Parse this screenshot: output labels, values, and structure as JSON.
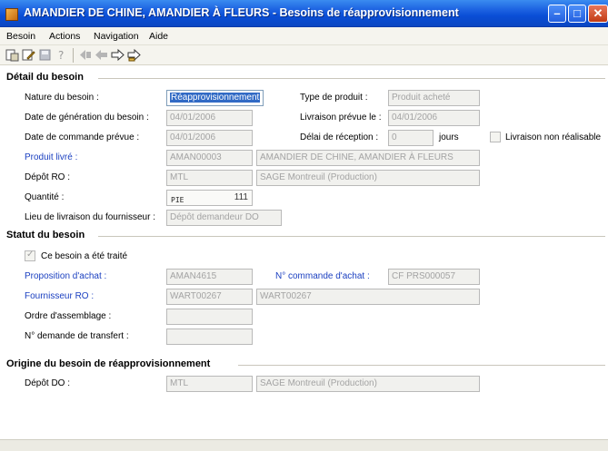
{
  "window": {
    "title": "AMANDIER DE CHINE, AMANDIER À FLEURS -  Besoins de réapprovisionnement"
  },
  "menu": [
    "Besoin",
    "Actions",
    "Navigation",
    "Aide"
  ],
  "toolbar_icons": [
    "new-icon",
    "edit-icon",
    "save-icon",
    "help-icon",
    "first-record-icon",
    "previous-record-icon",
    "next-record-icon",
    "last-record-icon"
  ],
  "detail": {
    "section_title": "Détail du besoin",
    "nature_label": "Nature du besoin :",
    "nature_value": "Réapprovisionnement",
    "type_produit_label": "Type de produit :",
    "type_produit_value": "Produit acheté",
    "date_generation_label": "Date de génération du besoin :",
    "date_generation_value": "04/01/2006",
    "livraison_prevue_label": "Livraison prévue le :",
    "livraison_prevue_value": "04/01/2006",
    "date_commande_label": "Date de commande prévue :",
    "date_commande_value": "04/01/2006",
    "delai_label": "Délai de réception :",
    "delai_value": "0",
    "delai_unit": "jours",
    "livraison_non_realisable_label": "Livraison non réalisable",
    "produit_livre_label": "Produit livré :",
    "produit_livre_code": "AMAN00003",
    "produit_livre_name": "AMANDIER DE CHINE, AMANDIER À FLEURS",
    "depot_ro_label": "Dépôt RO :",
    "depot_ro_code": "MTL",
    "depot_ro_name": "SAGE Montreuil (Production)",
    "quantite_label": "Quantité :",
    "quantite_unit": "PIE",
    "quantite_value": "111",
    "lieu_livraison_label": "Lieu de livraison du fournisseur :",
    "lieu_livraison_value": "Dépôt demandeur DO"
  },
  "statut": {
    "section_title": "Statut du besoin",
    "traite_label": "Ce besoin a été traité",
    "traite_checked": true,
    "proposition_label": "Proposition d'achat :",
    "proposition_value": "AMAN4615",
    "commande_label": "N° commande d'achat :",
    "commande_value": "CF PRS000057",
    "fournisseur_label": "Fournisseur RO :",
    "fournisseur_code": "WART00267",
    "fournisseur_name": "WART00267",
    "ordre_label": "Ordre d'assemblage :",
    "ordre_value": "",
    "transfert_label": "N° demande de transfert :",
    "transfert_value": ""
  },
  "origine": {
    "section_title": "Origine du besoin de réapprovisionnement",
    "depot_do_label": "Dépôt DO :",
    "depot_do_code": "MTL",
    "depot_do_name": "SAGE Montreuil (Production)"
  }
}
